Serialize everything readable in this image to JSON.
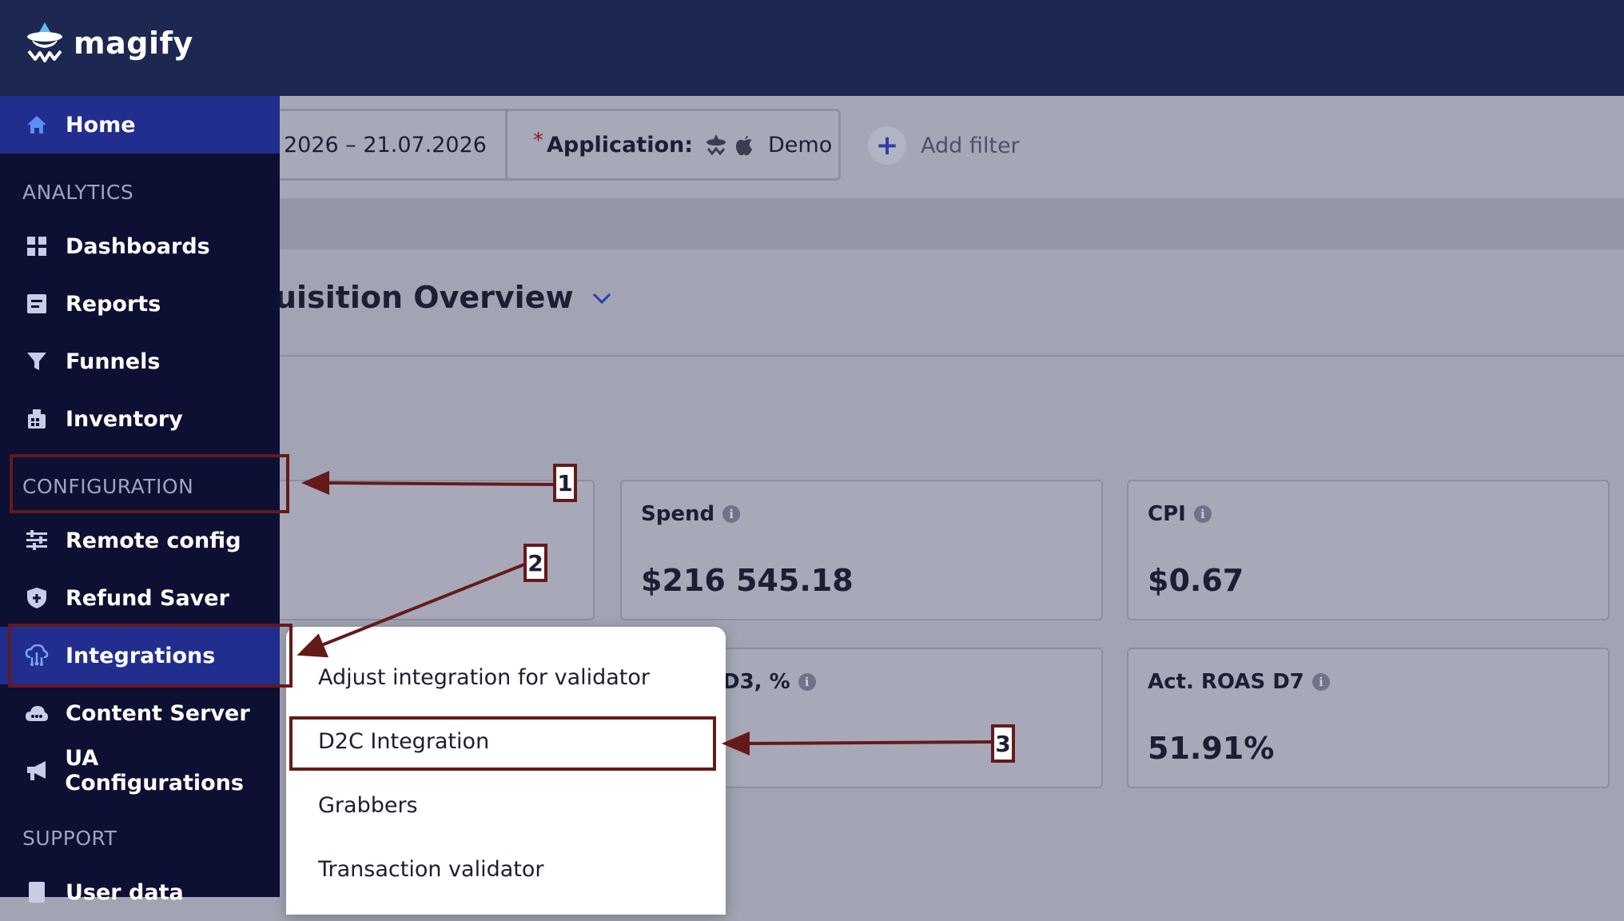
{
  "brand": {
    "name": "magify"
  },
  "filters": {
    "date_range": "2026 – 21.07.2026",
    "application_label": "Application:",
    "application_required_mark": "*",
    "application_value": "Demo",
    "add_filter_label": "Add filter"
  },
  "page": {
    "title": "uisition Overview"
  },
  "sidebar": {
    "home": "Home",
    "sections": {
      "analytics": "ANALYTICS",
      "configuration": "CONFIGURATION",
      "support": "SUPPORT"
    },
    "items": {
      "dashboards": "Dashboards",
      "reports": "Reports",
      "funnels": "Funnels",
      "inventory": "Inventory",
      "remote_config": "Remote config",
      "refund_saver": "Refund Saver",
      "integrations": "Integrations",
      "content_server": "Content Server",
      "ua_configurations": "UA Configurations",
      "user_data": "User data"
    }
  },
  "metrics": {
    "spend": {
      "label": "Spend",
      "value": "$216 545.18"
    },
    "cpi": {
      "label": "CPI",
      "value": "$0.67"
    },
    "partial": {
      "label": "D3, %"
    },
    "roas": {
      "label": "Act. ROAS D7",
      "value": "51.91%"
    }
  },
  "integrations_menu": [
    "Adjust integration for validator",
    "D2C Integration",
    "Grabbers",
    "Transaction validator"
  ],
  "annotations": [
    "1",
    "2",
    "3"
  ],
  "colors": {
    "topbar": "#1c2852",
    "sidebar": "#0d0f33",
    "active_nav": "#212e8e",
    "annotation": "#651a1a",
    "accent": "#2b3da6"
  }
}
